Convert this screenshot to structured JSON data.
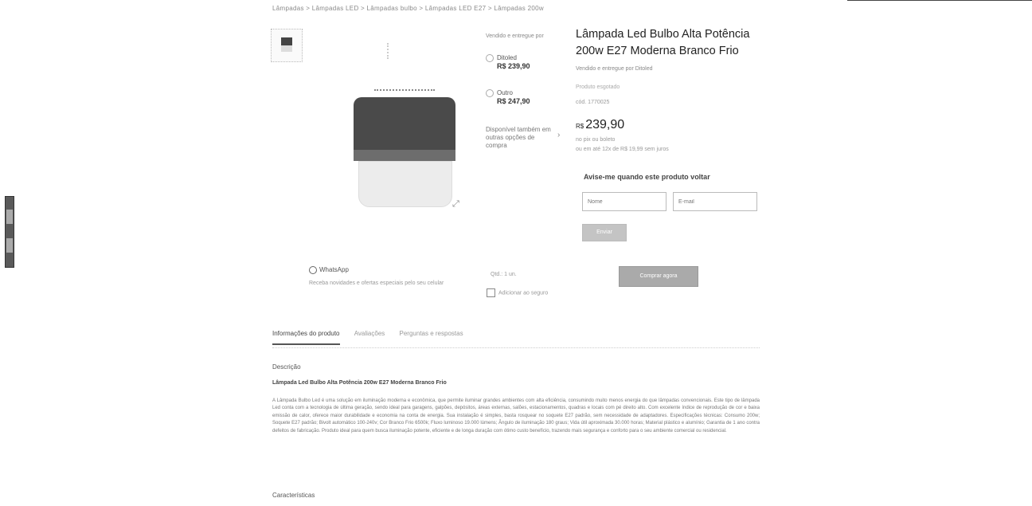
{
  "breadcrumb": "Lâmpadas > Lâmpadas LED > Lâmpadas bulbo > Lâmpadas LED E27 > Lâmpadas 200w",
  "product": {
    "title": "Lâmpada Led Bulbo Alta Potência 200w E27 Moderna Branco Frio",
    "seller_line": "Vendido e entregue por Ditoled",
    "availability": "Produto esgotado",
    "code": "cód. 1770025",
    "price_currency": "R$",
    "price_value": "239,90",
    "price_line1": "no pix ou boleto",
    "price_line2": "ou em até 12x de R$ 19,99 sem juros"
  },
  "other_sellers": {
    "header": "Vendido e entregue por",
    "options": [
      {
        "name": "Ditoled",
        "price": "R$ 239,90"
      },
      {
        "name": "Outro",
        "price": "R$ 247,90"
      }
    ],
    "more": "Disponível também em outras opções de compra"
  },
  "notify": {
    "title": "Avise-me quando este produto voltar",
    "name_placeholder": "Nome",
    "email_placeholder": "E-mail",
    "send_label": "Enviar"
  },
  "whatsapp": {
    "label": "WhatsApp",
    "sub": "Receba novidades e ofertas especiais pelo seu celular"
  },
  "purchase": {
    "qty_label": "Qtd.: 1 un.",
    "checkbox_label": "Adicionar ao seguro",
    "buy_label": "Comprar agora"
  },
  "tabs": [
    "Informações do produto",
    "Avaliações",
    "Perguntas e respostas"
  ],
  "description": {
    "header": "Descrição",
    "title": "Lâmpada Led Bulbo Alta Potência 200w E27 Moderna Branco Frio",
    "body": "A Lâmpada Bulbo Led é uma solução em iluminação moderna e econômica, que permite iluminar grandes ambientes com alta eficiência, consumindo muito menos energia do que lâmpadas convencionais. Este tipo de lâmpada Led conta com a tecnologia de última geração, sendo ideal para garagens, galpões, depósitos, áreas externas, salões, estacionamentos, quadras e locais com pé direito alto. Com excelente índice de reprodução de cor e baixa emissão de calor, oferece maior durabilidade e economia na conta de energia. Sua instalação é simples, basta rosquear no soquete E27 padrão, sem necessidade de adaptadores. Especificações técnicas: Consumo 200w; Soquete E27 padrão; Bivolt automático 100-240v; Cor Branco Frio 6500k; Fluxo luminoso 19.000 lúmens; Ângulo de iluminação 180 graus; Vida útil aproximada 30.000 horas; Material plástico e alumínio; Garantia de 1 ano contra defeitos de fabricação. Produto ideal para quem busca iluminação potente, eficiente e de longa duração com ótimo custo benefício, trazendo mais segurança e conforto para o seu ambiente comercial ou residencial."
  },
  "characteristics_header": "Características"
}
